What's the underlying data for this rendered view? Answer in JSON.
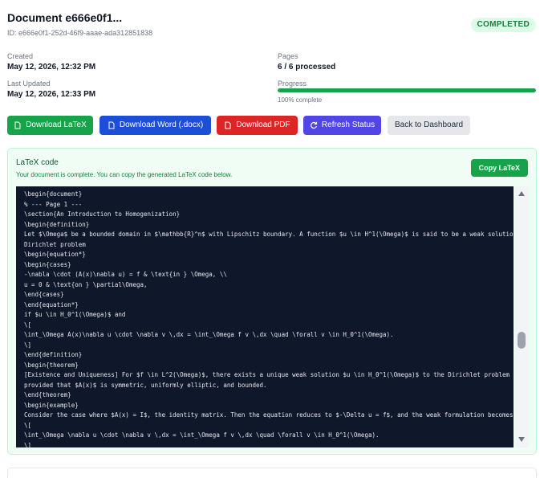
{
  "document": {
    "title": "Document e666e0f1...",
    "id_text": "ID: e666e0f1-252d-46f9-aaae-ada312851838",
    "status": "COMPLETED"
  },
  "meta": {
    "created_label": "Created",
    "created_value": "May 12, 2026, 12:32 PM",
    "updated_label": "Last Updated",
    "updated_value": "May 12, 2026, 12:33 PM",
    "pages_label": "Pages",
    "pages_value": "6 / 6 processed",
    "progress_label": "Progress",
    "progress_fraction": 1.0,
    "progress_note": "100% complete"
  },
  "actions": {
    "download_latex": "Download LaTeX",
    "download_word": "Download Word (.docx)",
    "download_pdf": "Download PDF",
    "refresh_status": "Refresh Status",
    "back_to_dashboard": "Back to Dashboard"
  },
  "latex_panel": {
    "title": "LaTeX code",
    "subtitle": "Your document is complete. You can copy the generated LaTeX code below.",
    "copy_button": "Copy LaTeX",
    "code_lines": [
      "\\begin{document}",
      "% --- Page 1 ---",
      "\\section{An Introduction to Homogenization}",
      "\\begin{definition}",
      "Let $\\Omega$ be a bounded domain in $\\mathbb{R}^n$ with Lipschitz boundary. A function $u \\in H^1(\\Omega)$ is said to be a weak solution of the",
      "Dirichlet problem",
      "\\begin{equation*}",
      "\\begin{cases}",
      "-\\nabla \\cdot (A(x)\\nabla u) = f & \\text{in } \\Omega, \\\\",
      "u = 0 & \\text{on } \\partial\\Omega,",
      "\\end{cases}",
      "\\end{equation*}",
      "if $u \\in H_0^1(\\Omega)$ and",
      "\\[",
      "\\int_\\Omega A(x)\\nabla u \\cdot \\nabla v \\,dx = \\int_\\Omega f v \\,dx \\quad \\forall v \\in H_0^1(\\Omega).",
      "\\]",
      "\\end{definition}",
      "\\begin{theorem}",
      "[Existence and Uniqueness] For $f \\in L^2(\\Omega)$, there exists a unique weak solution $u \\in H_0^1(\\Omega)$ to the Dirichlet problem above,",
      "provided that $A(x)$ is symmetric, uniformly elliptic, and bounded.",
      "\\end{theorem}",
      "\\begin{example}",
      "Consider the case where $A(x) = I$, the identity matrix. Then the equation reduces to $-\\Delta u = f$, and the weak formulation becomes",
      "\\[",
      "\\int_\\Omega \\nabla u \\cdot \\nabla v \\,dx = \\int_\\Omega f v \\,dx \\quad \\forall v \\in H_0^1(\\Omega).",
      "\\]"
    ]
  },
  "colors": {
    "success": "#16a34a",
    "primary": "#1d4ed8",
    "danger": "#dc2626",
    "accent": "#4f46e5",
    "code_bg": "#0f172a"
  },
  "icons": {
    "download_latex": "document-icon",
    "download_word": "document-icon",
    "download_pdf": "document-icon",
    "refresh_status": "refresh-icon"
  }
}
